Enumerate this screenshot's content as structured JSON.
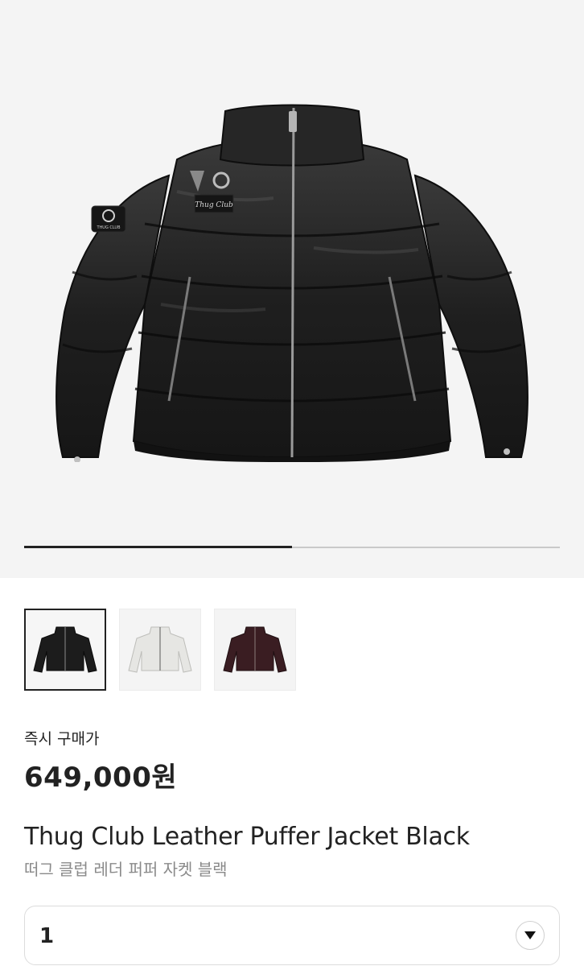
{
  "product": {
    "main_image": {
      "icon": "black-leather-puffer-jacket-image",
      "patch_text": "Thug Club",
      "sleeve_patch_text": "THUG CLUB"
    },
    "gallery_progress": 0.5,
    "thumbnails": [
      {
        "icon": "black-jacket-thumbnail",
        "color": "#1c1c1c",
        "selected": true
      },
      {
        "icon": "white-jacket-thumbnail",
        "color": "#e6e6e3",
        "selected": false
      },
      {
        "icon": "burgundy-jacket-thumbnail",
        "color": "#3a1d22",
        "selected": false
      }
    ],
    "price_label": "즉시 구매가",
    "price": "649,000원",
    "title_en": "Thug Club Leather Puffer Jacket Black",
    "title_ko": "떠그 클럽 레더 퍼퍼 자켓 블랙"
  },
  "quantity_select": {
    "value": "1",
    "icon": "chevron-down-icon"
  },
  "colors": {
    "hero_background": "#f4f4f4",
    "text_primary": "#222222",
    "text_secondary": "#8a8a8a",
    "border": "#dcdcdc"
  }
}
